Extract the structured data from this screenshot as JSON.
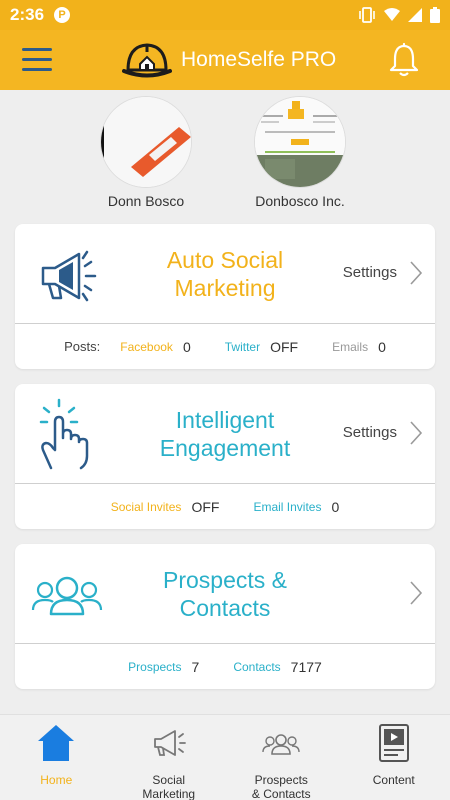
{
  "status_bar": {
    "time": "2:36",
    "app_badge": "P"
  },
  "app_bar": {
    "title": "HomeSelfe PRO"
  },
  "profiles": [
    {
      "name": "Donn Bosco"
    },
    {
      "name": "Donbosco Inc."
    }
  ],
  "cards": {
    "auto_social": {
      "title_line1": "Auto Social",
      "title_line2": "Marketing",
      "settings": "Settings",
      "posts_label": "Posts:",
      "facebook_label": "Facebook",
      "facebook_value": "0",
      "twitter_label": "Twitter",
      "twitter_value": "OFF",
      "emails_label": "Emails",
      "emails_value": "0"
    },
    "engagement": {
      "title_line1": "Intelligent",
      "title_line2": "Engagement",
      "settings": "Settings",
      "social_invites_label": "Social Invites",
      "social_invites_value": "OFF",
      "email_invites_label": "Email Invites",
      "email_invites_value": "0"
    },
    "prospects": {
      "title_line1": "Prospects &",
      "title_line2": "Contacts",
      "prospects_label": "Prospects",
      "prospects_value": "7",
      "contacts_label": "Contacts",
      "contacts_value": "7177"
    }
  },
  "bottom_nav": [
    {
      "label_line1": "Home",
      "label_line2": ""
    },
    {
      "label_line1": "Social",
      "label_line2": "Marketing"
    },
    {
      "label_line1": "Prospects",
      "label_line2": "& Contacts"
    },
    {
      "label_line1": "Content",
      "label_line2": ""
    }
  ],
  "colors": {
    "brand_yellow": "#f4b622",
    "accent_blue": "#2ab0c9",
    "icon_blue": "#2c5b8a"
  }
}
